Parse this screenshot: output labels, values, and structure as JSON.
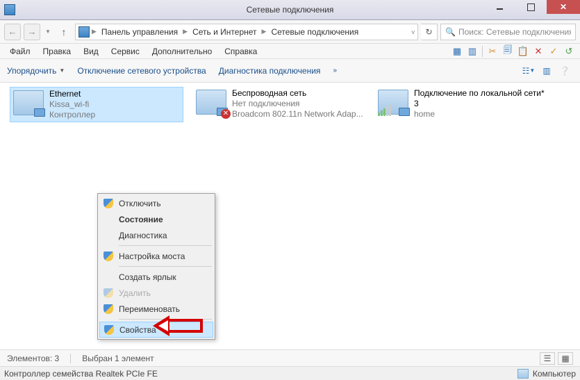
{
  "window": {
    "title": "Сетевые подключения",
    "min_btn": "−",
    "max_btn": "□",
    "close_btn": "✕"
  },
  "breadcrumb": {
    "seg1": "Панель управления",
    "seg2": "Сеть и Интернет",
    "seg3": "Сетевые подключения"
  },
  "search": {
    "placeholder": "Поиск: Сетевые подключения"
  },
  "menubar": {
    "file": "Файл",
    "edit": "Правка",
    "view": "Вид",
    "service": "Сервис",
    "extra": "Дополнительно",
    "help": "Справка"
  },
  "cmdbar": {
    "organize": "Упорядочить",
    "disable": "Отключение сетевого устройства",
    "diagnose": "Диагностика подключения"
  },
  "connections": {
    "ethernet": {
      "name": "Ethernet",
      "sub1": "Kissa_wi-fi",
      "sub2": "Контроллер"
    },
    "wifi": {
      "name": "Беспроводная сеть",
      "sub1": "Нет подключения",
      "sub2": "Broadcom 802.11n Network Adap..."
    },
    "local": {
      "name": "Подключение по локальной сети* 3",
      "sub2": "home"
    }
  },
  "context_menu": {
    "disable": "Отключить",
    "status": "Состояние",
    "diagnose": "Диагностика",
    "bridge": "Настройка моста",
    "shortcut": "Создать ярлык",
    "delete": "Удалить",
    "rename": "Переименовать",
    "properties": "Свойства"
  },
  "statusbar": {
    "count": "Элементов: 3",
    "selected": "Выбран 1 элемент",
    "device": "Контроллер семейства Realtek PCIe FE",
    "computer": "Компьютер"
  }
}
